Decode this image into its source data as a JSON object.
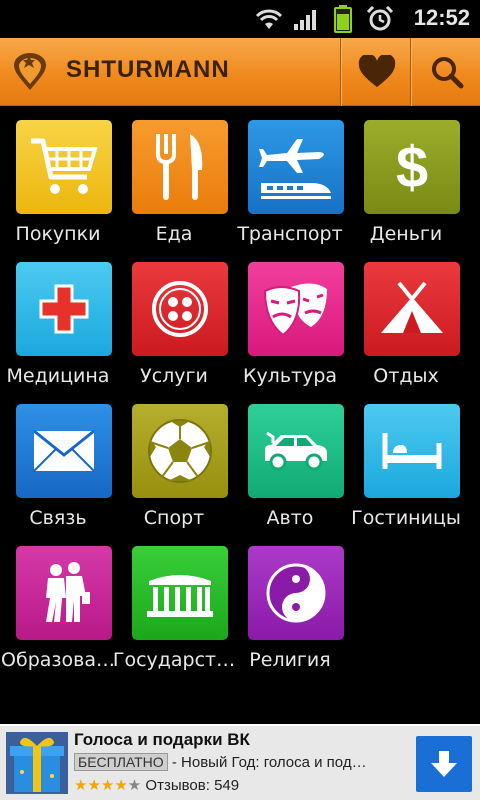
{
  "status_bar": {
    "time": "12:52",
    "icons": [
      "wifi-icon",
      "signal-icon",
      "battery-icon",
      "alarm-icon"
    ]
  },
  "header": {
    "brand": "SHTURMANN",
    "actions": [
      "favorites-heart-icon",
      "search-icon"
    ]
  },
  "categories": [
    {
      "label": "Покупки",
      "icon": "shopping-cart-icon",
      "color": "#f3c21b"
    },
    {
      "label": "Еда",
      "icon": "fork-knife-icon",
      "color": "#f28a12"
    },
    {
      "label": "Транспорт",
      "icon": "plane-train-icon",
      "color": "#1f88d8"
    },
    {
      "label": "Деньги",
      "icon": "dollar-icon",
      "color": "#8a9a1e"
    },
    {
      "label": "Медицина",
      "icon": "medical-cross-icon",
      "color": "#2bb8e8"
    },
    {
      "label": "Услуги",
      "icon": "button-icon",
      "color": "#e0262b"
    },
    {
      "label": "Культура",
      "icon": "theater-masks-icon",
      "color": "#ea2a8e"
    },
    {
      "label": "Отдых",
      "icon": "tent-icon",
      "color": "#e0262b"
    },
    {
      "label": "Связь",
      "icon": "envelope-icon",
      "color": "#1f7fd8"
    },
    {
      "label": "Спорт",
      "icon": "soccer-ball-icon",
      "color": "#a8a01e"
    },
    {
      "label": "Авто",
      "icon": "car-icon",
      "color": "#1fbf88"
    },
    {
      "label": "Гостиницы",
      "icon": "bed-icon",
      "color": "#2fb8e8"
    },
    {
      "label": "Образова…",
      "icon": "students-icon",
      "color": "#c8289a"
    },
    {
      "label": "Государст…",
      "icon": "government-building-icon",
      "color": "#2ab82a"
    },
    {
      "label": "Религия",
      "icon": "yin-yang-icon",
      "color": "#9a2ab8"
    }
  ],
  "ad": {
    "title": "Голоса и подарки ВК",
    "badge": "БЕСПЛАТНО",
    "description": " - Новый Год: голоса и под…",
    "rating_stars": "★★★★",
    "rating_empty": "★",
    "rating": 4,
    "reviews": "Отзывов: 549"
  }
}
